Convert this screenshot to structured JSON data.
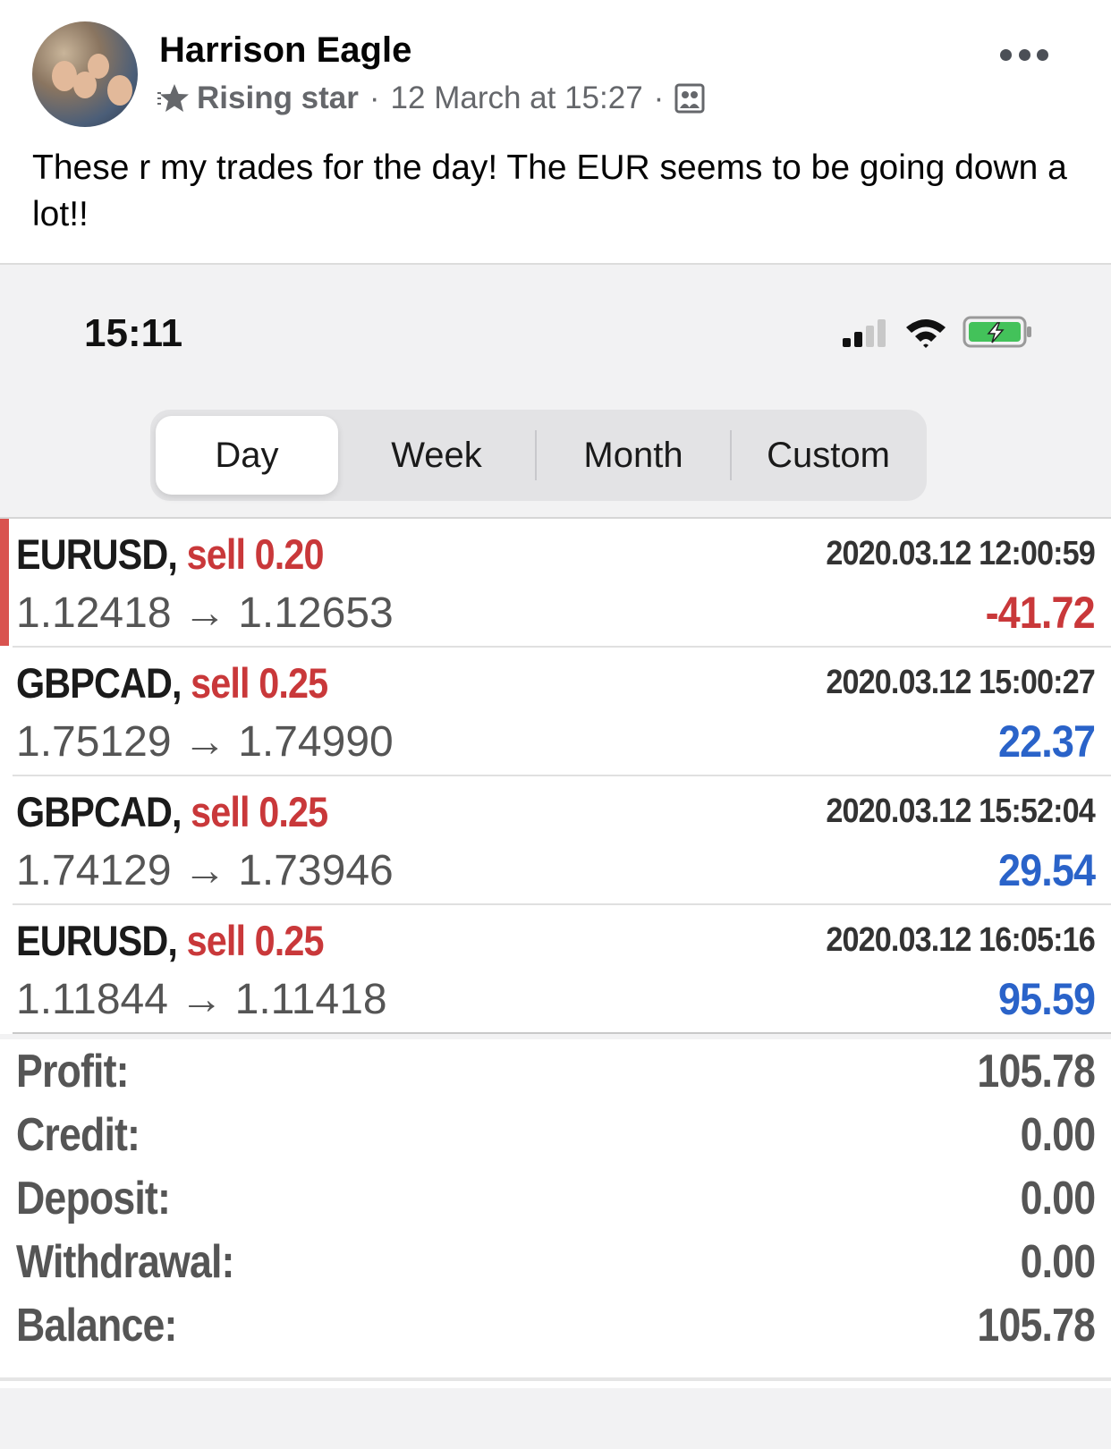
{
  "post": {
    "author": "Harrison Eagle",
    "badge": "Rising star",
    "separator": "·",
    "timestamp": "12 March at 15:27",
    "text": "These r my trades for the day! The EUR seems to be going down a lot!!"
  },
  "phone": {
    "status_time": "15:11",
    "tabs": [
      {
        "label": "Day",
        "active": true
      },
      {
        "label": "Week",
        "active": false
      },
      {
        "label": "Month",
        "active": false
      },
      {
        "label": "Custom",
        "active": false
      }
    ],
    "trades": [
      {
        "symbol": "EURUSD,",
        "side": "sell 0.20",
        "open": "1.12418",
        "arrow": "→",
        "close": "1.12653",
        "time": "2020.03.12 12:00:59",
        "profit": "-41.72",
        "loss": true
      },
      {
        "symbol": "GBPCAD,",
        "side": "sell 0.25",
        "open": "1.75129",
        "arrow": "→",
        "close": "1.74990",
        "time": "2020.03.12 15:00:27",
        "profit": "22.37",
        "loss": false
      },
      {
        "symbol": "GBPCAD,",
        "side": "sell 0.25",
        "open": "1.74129",
        "arrow": "→",
        "close": "1.73946",
        "time": "2020.03.12 15:52:04",
        "profit": "29.54",
        "loss": false
      },
      {
        "symbol": "EURUSD,",
        "side": "sell 0.25",
        "open": "1.11844",
        "arrow": "→",
        "close": "1.11418",
        "time": "2020.03.12 16:05:16",
        "profit": "95.59",
        "loss": false
      }
    ],
    "summary": [
      {
        "label": "Profit:",
        "value": "105.78"
      },
      {
        "label": "Credit:",
        "value": "0.00"
      },
      {
        "label": "Deposit:",
        "value": "0.00"
      },
      {
        "label": "Withdrawal:",
        "value": "0.00"
      },
      {
        "label": "Balance:",
        "value": "105.78"
      }
    ]
  },
  "colors": {
    "loss": "#c9383a",
    "gain": "#2a63c9",
    "sell": "#c9383a",
    "marker": "#d9534f"
  },
  "icons": {
    "badge": "star-icon",
    "audience": "group-icon",
    "more": "more-icon",
    "signal": "cellular-signal-icon",
    "wifi": "wifi-icon",
    "battery": "battery-charging-icon"
  }
}
